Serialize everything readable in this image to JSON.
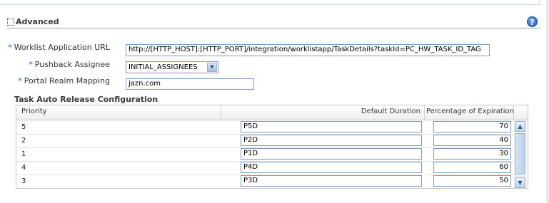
{
  "section": {
    "title": "Advanced",
    "help_label": "?"
  },
  "form": {
    "worklist_label": "Worklist Application URL",
    "worklist_value": "http://[HTTP_HOST]:[HTTP_PORT]/integration/worklistapp/TaskDetails?taskId=PC_HW_TASK_ID_TAG",
    "pushback_label": "Pushback Assignee",
    "pushback_value": "INITIAL_ASSIGNEES",
    "realm_label": "Portal Realm Mapping",
    "realm_value": "jazn.com",
    "required_marker": "*"
  },
  "table": {
    "title": "Task Auto Release Configuration",
    "columns": [
      "Priority",
      "Default Duration",
      "Percentage of Expiration"
    ],
    "rows": [
      {
        "priority": "5",
        "duration": "P5D",
        "percentage": "70"
      },
      {
        "priority": "2",
        "duration": "P2D",
        "percentage": "40"
      },
      {
        "priority": "1",
        "duration": "P1D",
        "percentage": "30"
      },
      {
        "priority": "4",
        "duration": "P4D",
        "percentage": "60"
      },
      {
        "priority": "3",
        "duration": "P3D",
        "percentage": "50"
      }
    ]
  },
  "icons": {
    "scroll_up": "▲",
    "scroll_down": "▼",
    "dropdown": "▼"
  }
}
